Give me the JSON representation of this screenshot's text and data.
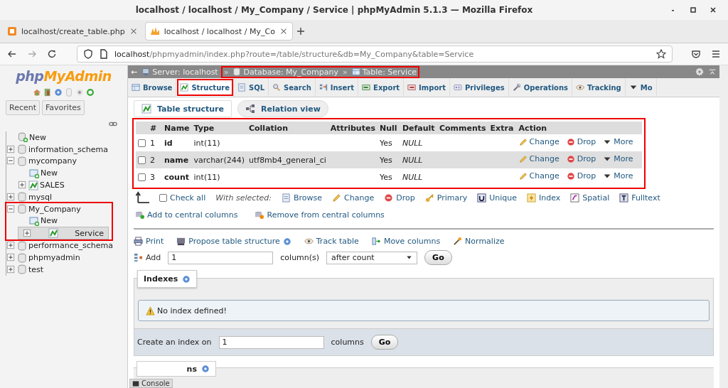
{
  "window": {
    "title": "localhost / localhost / My_Company / Service | phpMyAdmin 5.1.3 — Mozilla Firefox"
  },
  "browser_tabs": [
    {
      "label": "localhost/create_table.php",
      "selected": false
    },
    {
      "label": "localhost / localhost / My_Co",
      "selected": true
    }
  ],
  "address_bar": {
    "host": "localhost",
    "path": "/phpmyadmin/index.php?route=/table/structure&db=My_Company&table=Service"
  },
  "sidebar": {
    "logo": {
      "prefix": "php",
      "suffix": "MyAdmin"
    },
    "buttons": [
      "Recent",
      "Favorites"
    ],
    "tree": [
      {
        "label": "New",
        "kind": "new",
        "selected": false,
        "highlighted": false
      },
      {
        "label": "information_schema",
        "kind": "database",
        "expanded": false,
        "selected": false,
        "highlighted": false
      },
      {
        "label": "mycompany",
        "kind": "database",
        "expanded": true,
        "selected": false,
        "highlighted": false,
        "children": [
          {
            "label": "New",
            "kind": "new",
            "selected": false,
            "highlighted": false
          },
          {
            "label": "SALES",
            "kind": "table",
            "expanded": false,
            "selected": false,
            "highlighted": false
          }
        ]
      },
      {
        "label": "mysql",
        "kind": "database",
        "expanded": false,
        "selected": false,
        "highlighted": false
      },
      {
        "label": "My_Company",
        "kind": "database",
        "expanded": true,
        "selected": false,
        "highlighted": true,
        "children": [
          {
            "label": "New",
            "kind": "new",
            "selected": false,
            "highlighted": false
          },
          {
            "label": "Service",
            "kind": "table",
            "expanded": false,
            "selected": true,
            "highlighted": false
          }
        ]
      },
      {
        "label": "performance_schema",
        "kind": "database",
        "expanded": false,
        "selected": false,
        "highlighted": false
      },
      {
        "label": "phpmyadmin",
        "kind": "database",
        "expanded": false,
        "selected": false,
        "highlighted": false
      },
      {
        "label": "test",
        "kind": "database",
        "expanded": false,
        "selected": false,
        "highlighted": false
      }
    ]
  },
  "breadcrumb": {
    "back": "←",
    "separator": "»",
    "items": [
      {
        "label": "Server: localhost",
        "highlighted": false
      },
      {
        "label": "Database: My_Company",
        "highlighted": true
      },
      {
        "label": "Table: Service",
        "highlighted": true
      }
    ]
  },
  "tabs": [
    {
      "label": "Browse",
      "selected": false,
      "highlighted": false
    },
    {
      "label": "Structure",
      "selected": true,
      "highlighted": true
    },
    {
      "label": "SQL",
      "selected": false,
      "highlighted": false
    },
    {
      "label": "Search",
      "selected": false,
      "highlighted": false
    },
    {
      "label": "Insert",
      "selected": false,
      "highlighted": false
    },
    {
      "label": "Export",
      "selected": false,
      "highlighted": false
    },
    {
      "label": "Import",
      "selected": false,
      "highlighted": false
    },
    {
      "label": "Privileges",
      "selected": false,
      "highlighted": false
    },
    {
      "label": "Operations",
      "selected": false,
      "highlighted": false
    },
    {
      "label": "Tracking",
      "selected": false,
      "highlighted": false
    },
    {
      "label": "Mo",
      "selected": false,
      "highlighted": false
    }
  ],
  "subtabs": [
    {
      "label": "Table structure",
      "selected": true
    },
    {
      "label": "Relation view",
      "selected": false
    }
  ],
  "structure_table": {
    "highlighted": true,
    "columns": [
      "#",
      "Name",
      "Type",
      "Collation",
      "Attributes",
      "Null",
      "Default",
      "Comments",
      "Extra",
      "Action"
    ],
    "rows": [
      {
        "checked": false,
        "number": "1",
        "name": "id",
        "type": "int(11)",
        "null": "Yes",
        "default": "NULL",
        "actions": [
          "Change",
          "Drop",
          "More"
        ]
      },
      {
        "checked": false,
        "number": "2",
        "name": "name",
        "type": "varchar(244)",
        "collation": "utf8mb4_general_ci",
        "null": "Yes",
        "default": "NULL",
        "actions": [
          "Change",
          "Drop",
          "More"
        ]
      },
      {
        "checked": false,
        "number": "3",
        "name": "count",
        "type": "int(11)",
        "null": "Yes",
        "default": "NULL",
        "actions": [
          "Change",
          "Drop",
          "More"
        ]
      }
    ]
  },
  "bulk_actions": {
    "check_all": "Check all",
    "checked": false,
    "with_selected": "With selected:",
    "actions": [
      "Browse",
      "Change",
      "Drop",
      "Primary",
      "Unique",
      "Index",
      "Spatial",
      "Fulltext"
    ],
    "central": [
      "Add to central columns",
      "Remove from central columns"
    ]
  },
  "table_links": [
    "Print",
    "Propose table structure",
    "Track table",
    "Move columns",
    "Normalize"
  ],
  "add_columns": {
    "label": "Add",
    "value": "1",
    "unit": "column(s)",
    "position": "after count",
    "button": "Go"
  },
  "indexes": {
    "title": "Indexes",
    "notice": "No index defined!",
    "create_label": "Create an index on",
    "value": "1",
    "unit": "columns",
    "button": "Go"
  },
  "partial_section": {
    "title": "ns"
  },
  "console": {
    "label": "Console"
  }
}
